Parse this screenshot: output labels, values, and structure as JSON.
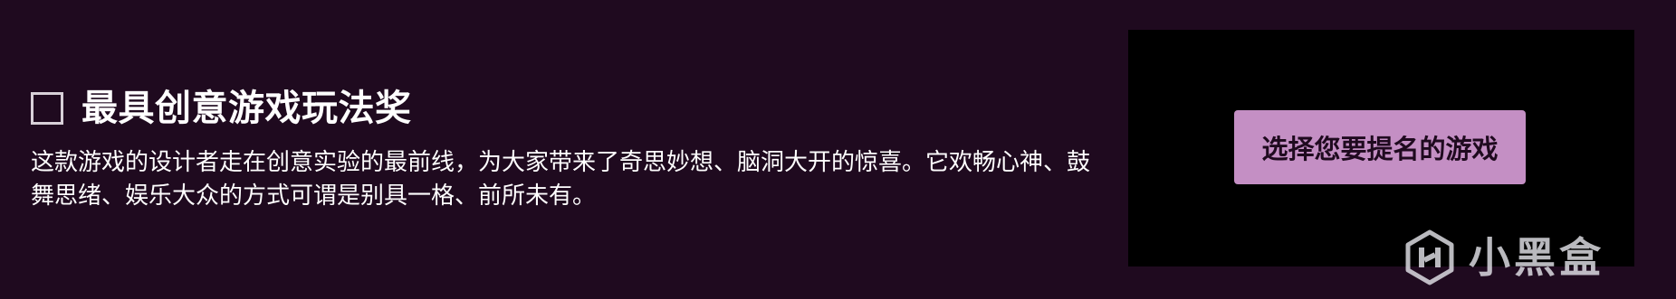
{
  "award": {
    "title": "最具创意游戏玩法奖",
    "description": "这款游戏的设计者走在创意实验的最前线，为大家带来了奇思妙想、脑洞大开的惊喜。它欢畅心神、鼓舞思绪、娱乐大众的方式可谓是别具一格、前所未有。",
    "checked": false
  },
  "nominate": {
    "button_label": "选择您要提名的游戏"
  },
  "watermark": {
    "text": "小黑盒",
    "icon": "heybox-logo-icon"
  },
  "colors": {
    "background": "#1f0a1f",
    "panel": "#000000",
    "button": "#c48fc4",
    "button_text": "#1f0a1f",
    "text": "#ffffff"
  }
}
